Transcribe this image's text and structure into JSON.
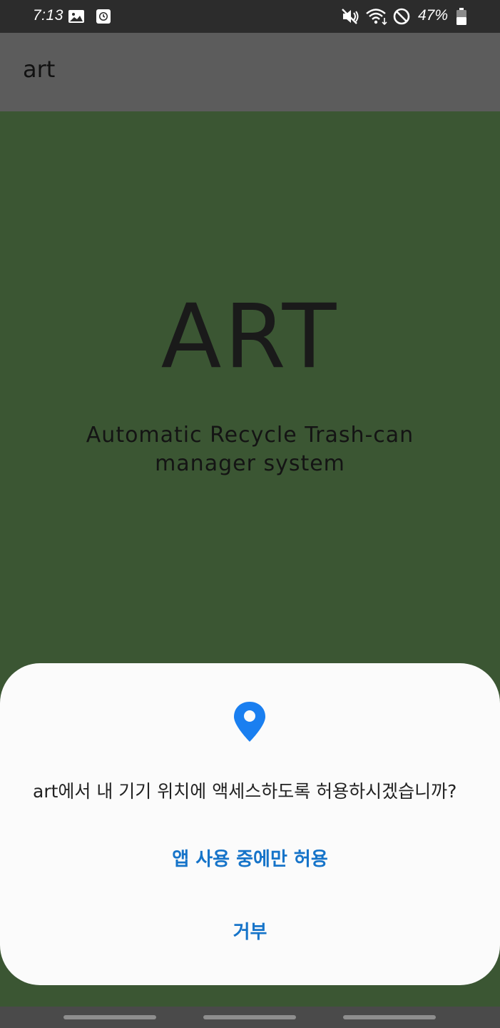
{
  "status_bar": {
    "time": "7:13",
    "battery_percent": "47%",
    "icons": [
      "gallery-icon",
      "clock-icon",
      "mute-icon",
      "wifi-icon",
      "do-not-disturb-icon",
      "battery-icon"
    ]
  },
  "app_bar": {
    "title": "art"
  },
  "main": {
    "logo": "ART",
    "subtitle_line1": "Automatic Recycle Trash-can",
    "subtitle_line2": "manager system"
  },
  "dialog": {
    "icon": "location-pin-icon",
    "message": "art에서 내 기기 위치에 액세스하도록 허용하시겠습니까?",
    "allow_label": "앱 사용 중에만 허용",
    "deny_label": "거부"
  },
  "colors": {
    "background": "#3b5633",
    "app_bar": "#5c5c5c",
    "status_bar": "#2c2c2c",
    "dialog": "#fbfbfb",
    "accent": "#1674c9",
    "icon_blue": "#1a7ff0"
  }
}
